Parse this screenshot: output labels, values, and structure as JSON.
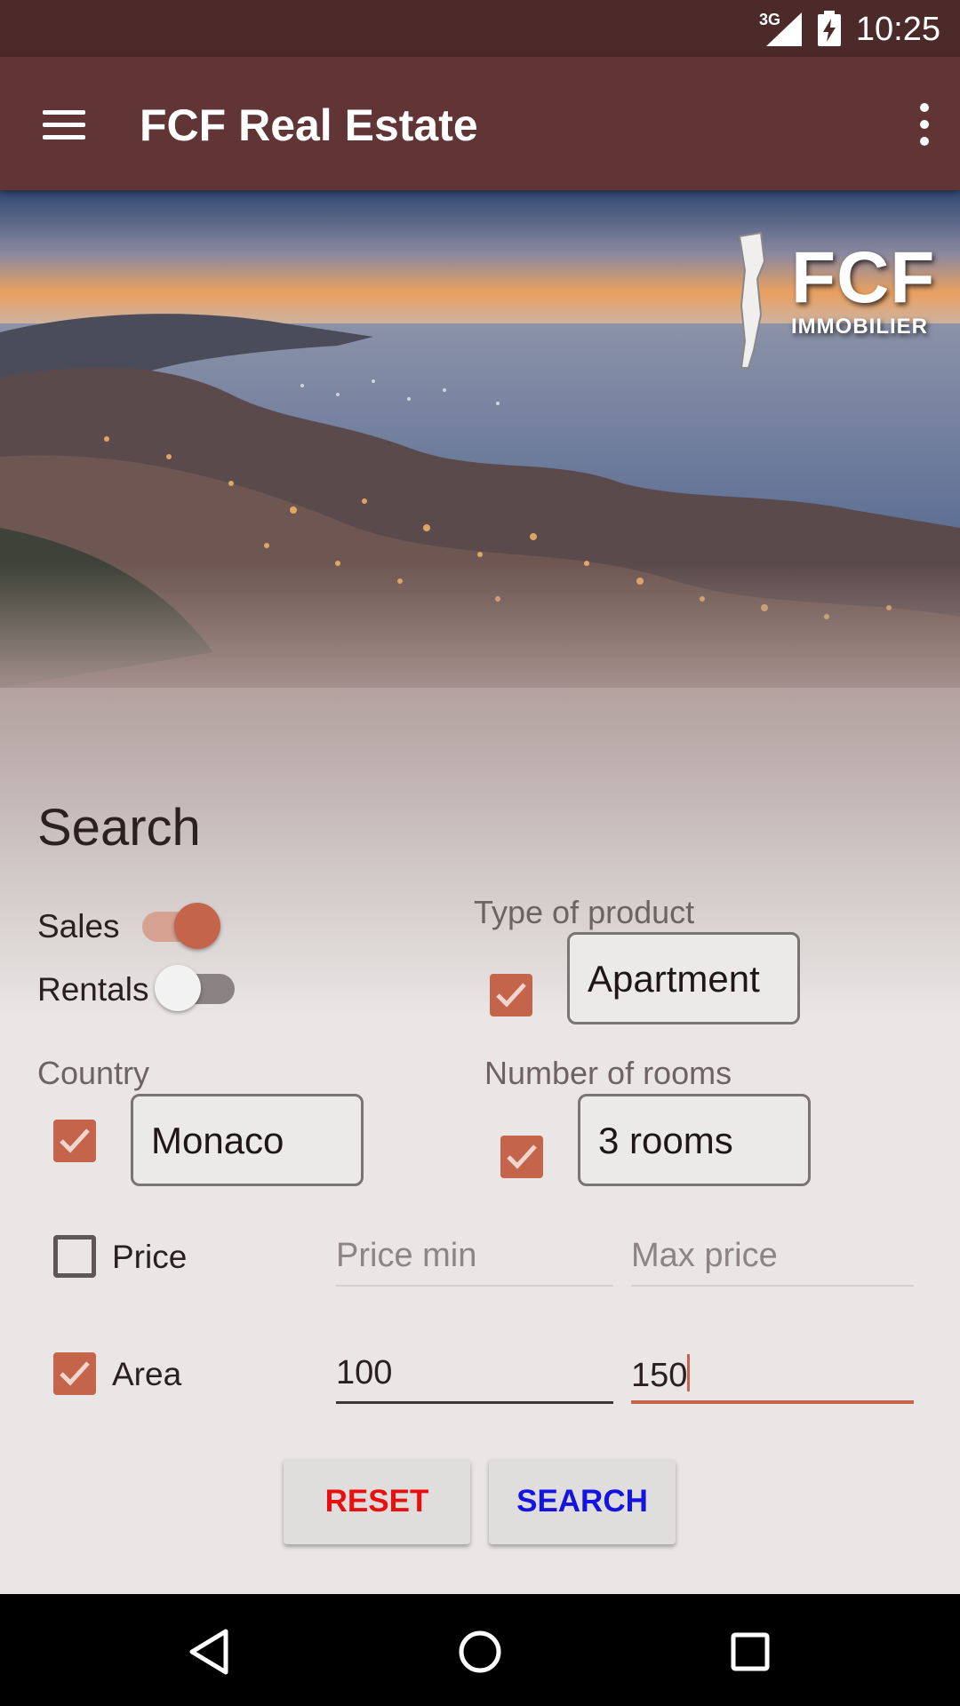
{
  "status_bar": {
    "time": "10:25",
    "network": "3G"
  },
  "app_bar": {
    "title": "FCF Real Estate"
  },
  "hero": {
    "logo_main": "FCF",
    "logo_sub": "IMMOBILIER"
  },
  "search": {
    "title": "Search",
    "sales_label": "Sales",
    "sales_on": true,
    "rentals_label": "Rentals",
    "rentals_on": false,
    "type_of_product": {
      "label": "Type of product",
      "checked": true,
      "value": "Apartment"
    },
    "country": {
      "label": "Country",
      "checked": true,
      "value": "Monaco"
    },
    "rooms": {
      "label": "Number of rooms",
      "checked": true,
      "value": "3 rooms"
    },
    "price": {
      "label": "Price",
      "checked": false,
      "min_placeholder": "Price min",
      "max_placeholder": "Max price"
    },
    "area": {
      "label": "Area",
      "checked": true,
      "min_value": "100",
      "max_value": "150"
    }
  },
  "buttons": {
    "reset_label": "RESET",
    "reset_color": "#e8100f",
    "search_label": "SEARCH",
    "search_color": "#1414e0"
  },
  "colors": {
    "status_bar": "#4c2a2a",
    "app_bar": "#613536",
    "accent": "#c4644b"
  },
  "icons": {
    "menu": "hamburger-menu-icon",
    "more": "more-vert-icon",
    "back": "back-triangle-icon",
    "home": "home-circle-icon",
    "recents": "recents-square-icon"
  }
}
